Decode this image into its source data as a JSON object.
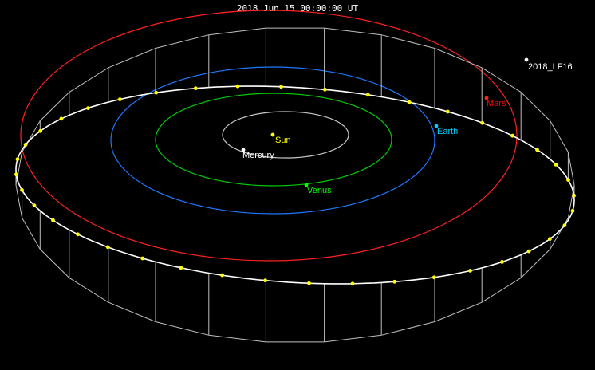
{
  "timestamp": "2018 Jun 15 00:00:00 UT",
  "bodies": [
    {
      "key": "sun",
      "label": "Sun",
      "color": "#ffff00"
    },
    {
      "key": "mercury",
      "label": "Mercury",
      "color": "#ffffff"
    },
    {
      "key": "venus",
      "label": "Venus",
      "color": "#00ff00"
    },
    {
      "key": "earth",
      "label": "Earth",
      "color": "#00ccff"
    },
    {
      "key": "mars",
      "label": "Mars",
      "color": "#ff0000"
    },
    {
      "key": "asteroid",
      "label": "2018_LF16",
      "color": "#ffffff"
    }
  ],
  "colors": {
    "background": "#000000",
    "mercury_orbit": "#c8c8c8",
    "venus_orbit": "#00cc00",
    "earth_orbit": "#1e78ff",
    "mars_orbit": "#ff2020",
    "asteroid_orbit": "#ffffff",
    "asteroid_markers": "#ffff00",
    "drop_lines": "#bfbfbf"
  }
}
